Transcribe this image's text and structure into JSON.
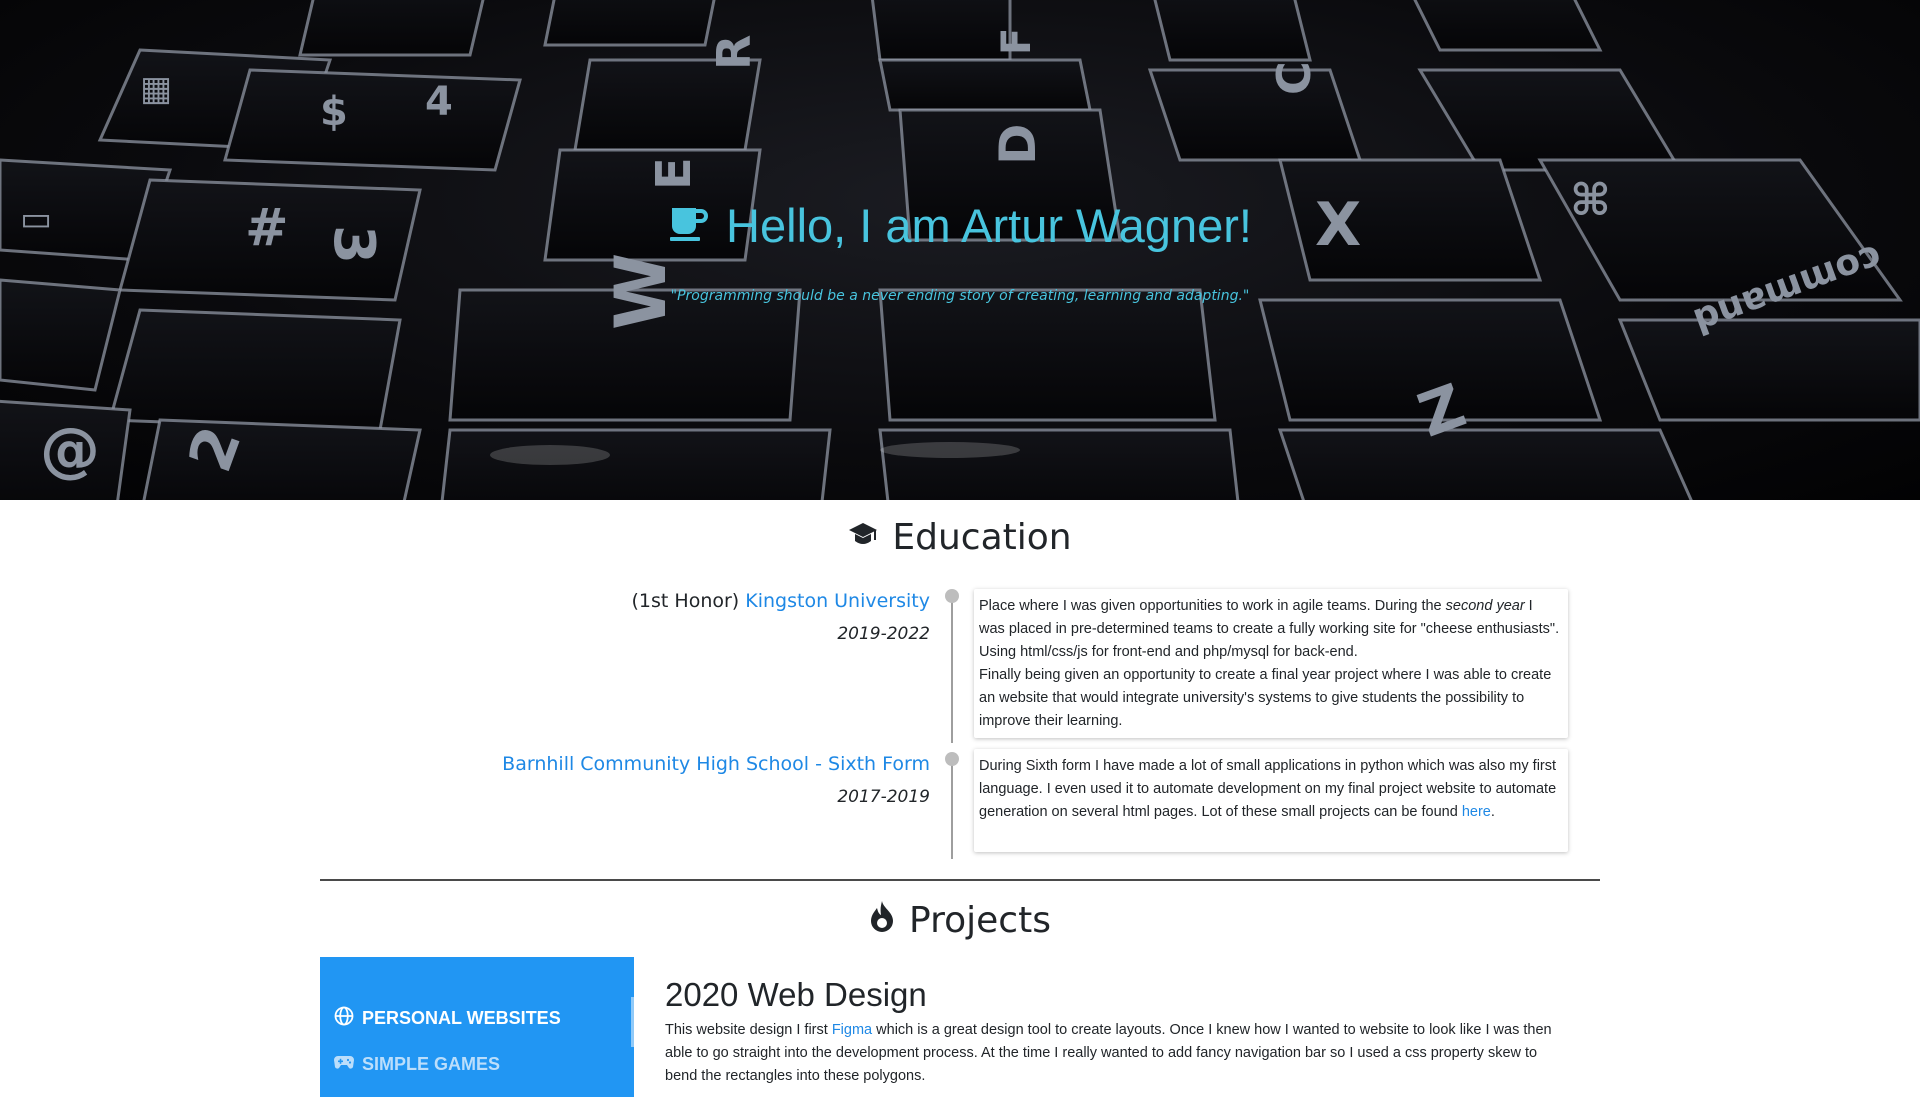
{
  "hero": {
    "title": "Hello, I am Artur Wagner!",
    "quote": "\"Programming should be a never ending story of creating, learning and adapting.\"",
    "icon": "coffee-cup-icon",
    "accent_color": "#48c4de"
  },
  "education": {
    "title": "Education",
    "icon": "graduation-cap-icon",
    "entries": [
      {
        "prefix": "(1st Honor) ",
        "school": "Kingston University",
        "years": "2019-2022",
        "text_1": "Place where I was given opportunities to work in agile teams. During the ",
        "emphasis": "second year",
        "text_2": " I was placed in pre-determined teams to create a fully working site for \"cheese enthusiasts\". Using html/css/js for front-end and php/mysql for back-end.",
        "text_3": "Finally being given an opportunity to create a final year project where I was able to create an website that would integrate university's systems to give students the possibility to improve their learning."
      },
      {
        "prefix": "",
        "school": "Barnhill Community High School - Sixth Form",
        "years": "2017-2019",
        "text_1": "During Sixth form I have made a lot of small applications in python which was also my first language. I even used it to automate development on my final project website to automate generation on several html pages. Lot of these small projects can be found ",
        "link": "here",
        "text_2": "."
      }
    ]
  },
  "projects": {
    "title": "Projects",
    "icon": "fire-icon",
    "categories": [
      {
        "label": "PERSONAL WEBSITES",
        "icon": "globe-icon",
        "active": true
      },
      {
        "label": "SIMPLE GAMES",
        "icon": "gamepad-icon",
        "active": false
      }
    ],
    "active_project": {
      "title": "2020 Web Design",
      "text_1": "This website design I first ",
      "link": "Figma",
      "text_2": " which is a great design tool to create layouts. Once I knew how I wanted to website to look like I was then able to go straight into the development process. At the time I really wanted to add fancy navigation bar so I used a css property skew to bend the rectangles into these polygons."
    },
    "sidebar_color": "#2196f3"
  }
}
